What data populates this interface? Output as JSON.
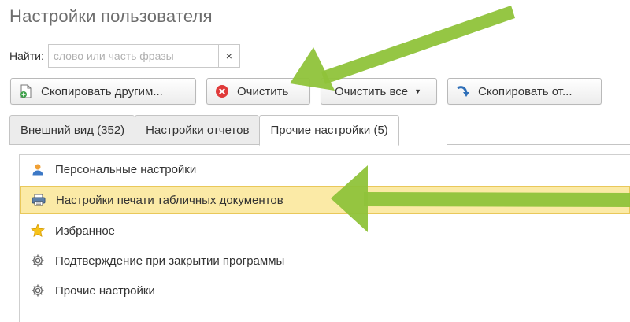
{
  "page": {
    "title": "Настройки пользователя"
  },
  "search": {
    "label": "Найти:",
    "placeholder": "слово или часть фразы",
    "value": "",
    "clear_icon": "×"
  },
  "toolbar": {
    "copy_others_label": "Скопировать другим...",
    "clear_label": "Очистить",
    "clear_all_label": "Очистить все",
    "copy_from_label": "Скопировать от...",
    "dropdown_caret": "▼"
  },
  "tabs": [
    {
      "label": "Внешний вид (352)",
      "active": false
    },
    {
      "label": "Настройки отчетов",
      "active": false
    },
    {
      "label": "Прочие настройки (5)",
      "active": true
    }
  ],
  "settings_list": [
    {
      "label": "Персональные настройки",
      "icon": "user-icon",
      "selected": false
    },
    {
      "label": "Настройки печати табличных документов",
      "icon": "printer-icon",
      "selected": true
    },
    {
      "label": "Избранное",
      "icon": "star-icon",
      "selected": false
    },
    {
      "label": "Подтверждение при закрытии программы",
      "icon": "gear-icon",
      "selected": false
    },
    {
      "label": "Прочие настройки",
      "icon": "gear-icon",
      "selected": false
    }
  ],
  "colors": {
    "selection": "#fbeaa6",
    "annotation_arrow": "#8fc33a",
    "clear_icon": "#e03a3a",
    "copy_from_icon": "#2f6fb8"
  }
}
